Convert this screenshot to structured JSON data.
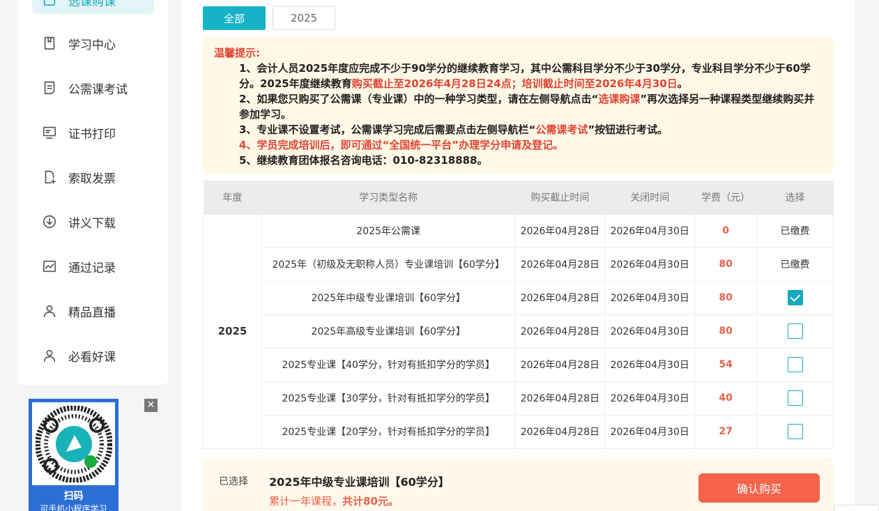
{
  "sidebar": {
    "items": [
      {
        "label": "选课购课",
        "icon": "cart-icon",
        "active": true
      },
      {
        "label": "学习中心",
        "icon": "book-icon"
      },
      {
        "label": "公需课考试",
        "icon": "exam-icon"
      },
      {
        "label": "证书打印",
        "icon": "certificate-icon"
      },
      {
        "label": "索取发票",
        "icon": "invoice-icon"
      },
      {
        "label": "讲义下载",
        "icon": "download-icon"
      },
      {
        "label": "通过记录",
        "icon": "chart-icon"
      },
      {
        "label": "精品直播",
        "icon": "user-icon"
      },
      {
        "label": "必看好课",
        "icon": "user-icon"
      }
    ]
  },
  "qr": {
    "line1": "扫码",
    "line2": "可手机小程序学习"
  },
  "tabs": {
    "all": "全部",
    "year": "2025"
  },
  "notice": {
    "title": "温馨提示:",
    "p1": "1、会计人员2025年度应完成不少于90学分的继续教育学习，其中公需科目学分不少于30学分，专业科目学分不少于60学分。2025年度继续教育",
    "p1_red": "购买截止至2026年4月28日24点；培训截止时间至2026年4月30日",
    "p1_end": "。",
    "p2a": "2、如果您只购买了公需课（专业课）中的一种学习类型，请在左侧导航点击“",
    "p2_red": "选课购课",
    "p2b": "”再次选择另一种课程类型继续购买并参加学习。",
    "p3a": "3、专业课不设置考试，公需课学习完成后需要点击左侧导航栏“",
    "p3_red": "公需课考试",
    "p3b": "”按钮进行考试。",
    "p4": "4、学员完成培训后，即可通过“全国统一平台”办理学分申请及登记。",
    "p5": "5、继续教育团体报名咨询电话：010-82318888。"
  },
  "table": {
    "headers": [
      "年度",
      "学习类型名称",
      "购买截止时间",
      "关闭时间",
      "学费（元）",
      "选择"
    ],
    "year": "2025",
    "rows": [
      {
        "name": "2025年公需课",
        "buy_deadline": "2026年04月28日",
        "close": "2026年04月30日",
        "fee": "0",
        "select": "已缴费"
      },
      {
        "name": "2025年（初级及无职称人员）专业课培训【60学分】",
        "buy_deadline": "2026年04月28日",
        "close": "2026年04月30日",
        "fee": "80",
        "select": "已缴费"
      },
      {
        "name": "2025年中级专业课培训【60学分】",
        "buy_deadline": "2026年04月28日",
        "close": "2026年04月30日",
        "fee": "80",
        "select": "checked"
      },
      {
        "name": "2025年高级专业课培训【60学分】",
        "buy_deadline": "2026年04月28日",
        "close": "2026年04月30日",
        "fee": "80",
        "select": "unchecked"
      },
      {
        "name": "2025专业课【40学分，针对有抵扣学分的学员】",
        "buy_deadline": "2026年04月28日",
        "close": "2026年04月30日",
        "fee": "54",
        "select": "unchecked"
      },
      {
        "name": "2025专业课【30学分，针对有抵扣学分的学员】",
        "buy_deadline": "2026年04月28日",
        "close": "2026年04月30日",
        "fee": "40",
        "select": "unchecked"
      },
      {
        "name": "2025专业课【20学分，针对有抵扣学分的学员】",
        "buy_deadline": "2026年04月28日",
        "close": "2026年04月30日",
        "fee": "27",
        "select": "unchecked"
      }
    ]
  },
  "summary": {
    "label": "已选择",
    "name": "2025年中级专业课培训【60学分】",
    "total_prefix": "累计一年课程，",
    "total_bold": "共计80元。",
    "buy_button": "确认购买"
  },
  "colors": {
    "accent": "#16b3c7",
    "price": "#e8614a",
    "notice_bg": "#fff8e6",
    "buy": "#f4634a"
  }
}
